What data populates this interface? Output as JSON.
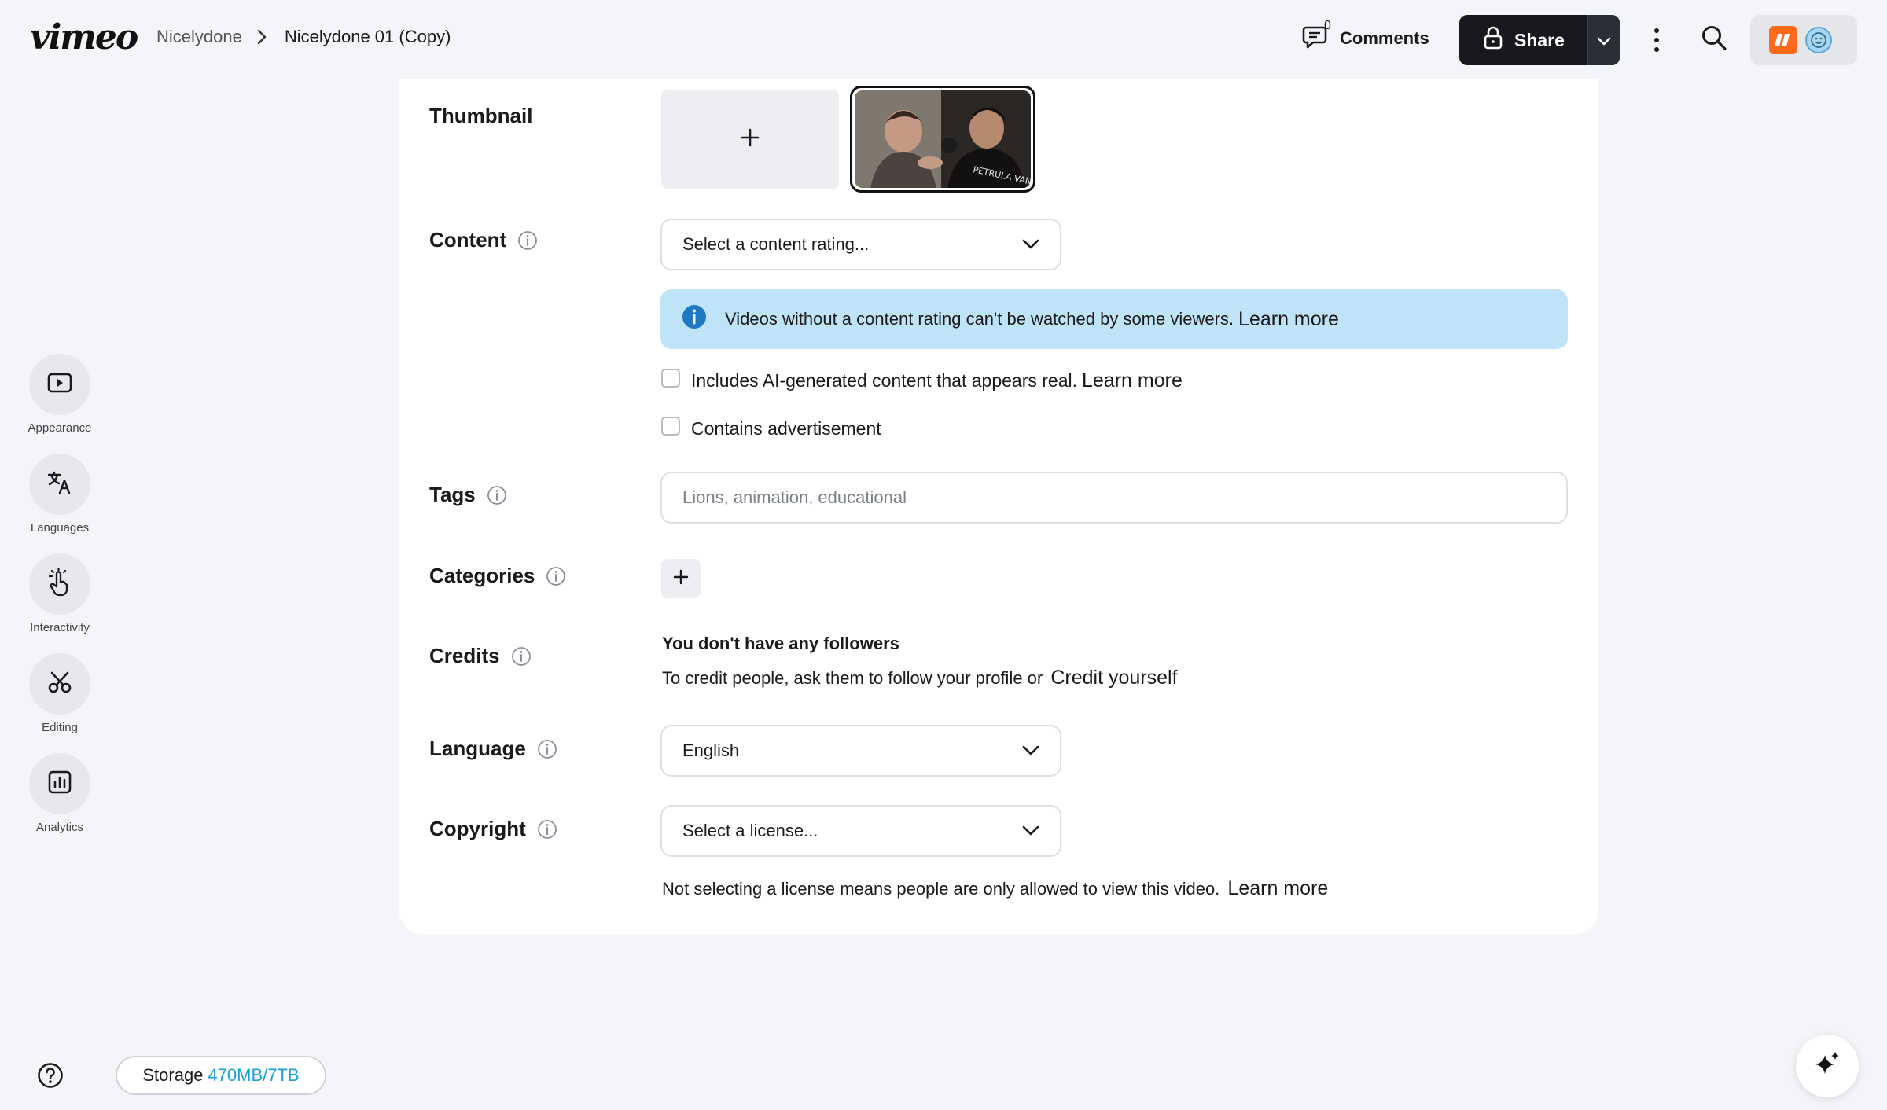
{
  "header": {
    "logo": "vimeo",
    "breadcrumb": [
      "Nicelydone",
      "Nicelydone 01 (Copy)"
    ],
    "comments_count": "0",
    "comments_label": "Comments",
    "share_label": "Share"
  },
  "sidebar": {
    "items": [
      {
        "label": "Appearance",
        "icon": "play-square-icon"
      },
      {
        "label": "Languages",
        "icon": "translate-icon"
      },
      {
        "label": "Interactivity",
        "icon": "pointer-click-icon"
      },
      {
        "label": "Editing",
        "icon": "scissors-icon"
      },
      {
        "label": "Analytics",
        "icon": "bar-chart-icon"
      }
    ]
  },
  "form": {
    "thumbnail_label": "Thumbnail",
    "content_label": "Content",
    "content_select": "Select a content rating...",
    "notice_text": "Videos without a content rating can't be watched by some viewers.",
    "notice_link": "Learn more",
    "ai_check_text": "Includes AI-generated content that appears real.",
    "ai_check_link": "Learn more",
    "ad_check_text": "Contains advertisement",
    "tags_label": "Tags",
    "tags_placeholder": "Lions, animation, educational",
    "categories_label": "Categories",
    "credits_label": "Credits",
    "credits_title": "You don't have any followers",
    "credits_text": "To credit people, ask them to follow your profile or",
    "credits_link": "Credit yourself",
    "language_label": "Language",
    "language_value": "English",
    "copyright_label": "Copyright",
    "copyright_select": "Select a license...",
    "copyright_note": "Not selecting a license means people are only allowed to view this video.",
    "copyright_link": "Learn more"
  },
  "footer": {
    "storage_label": "Storage",
    "storage_value": "470MB/7TB"
  },
  "colors": {
    "accent_blue": "#1a9fd6",
    "notice_bg": "#bfe3f7",
    "share_bg": "#17191e",
    "brand_orange": "#ff6b1a"
  }
}
